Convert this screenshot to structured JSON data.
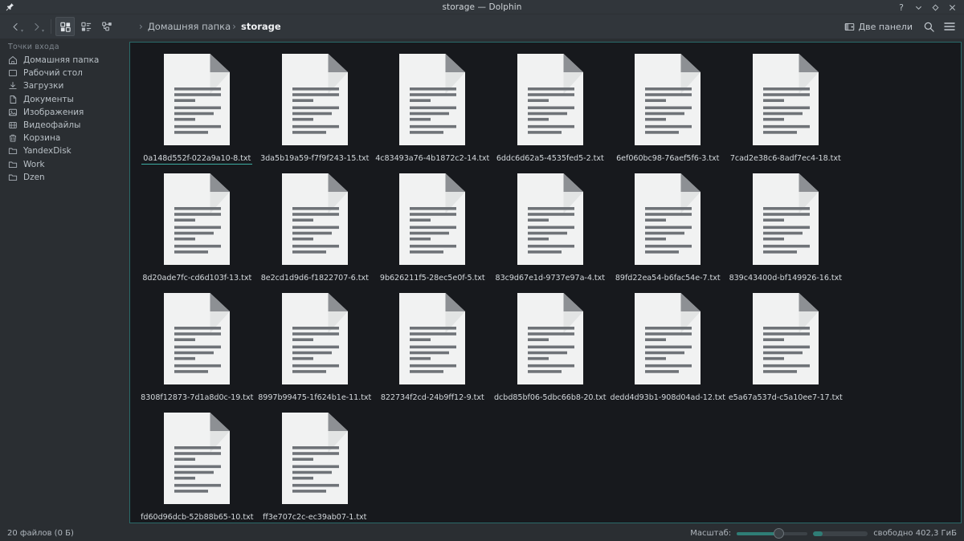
{
  "window": {
    "title": "storage — Dolphin",
    "pin_icon": "pin-icon",
    "controls": [
      {
        "name": "help-button",
        "glyph": "?"
      },
      {
        "name": "minimize-button",
        "glyph": "⌄"
      },
      {
        "name": "maximize-button",
        "glyph": "◇"
      },
      {
        "name": "close-button",
        "glyph": "✕"
      }
    ]
  },
  "toolbar": {
    "back_label": "‹",
    "forward_label": "›",
    "view_modes": [
      {
        "name": "view-mode-icons",
        "label": "Значки",
        "active": true
      },
      {
        "name": "view-mode-compact",
        "label": "Таблица",
        "active": false
      },
      {
        "name": "view-mode-details",
        "label": "Подробности",
        "active": false
      }
    ],
    "split_view_label": "Две панели",
    "search_label": "Поиск",
    "menu_label": "Меню"
  },
  "breadcrumb": {
    "items": [
      {
        "label": "Домашняя папка",
        "current": false
      },
      {
        "label": "storage",
        "current": true
      }
    ]
  },
  "sidebar": {
    "header": "Точки входа",
    "items": [
      {
        "label": "Домашняя папка",
        "icon": "home-icon"
      },
      {
        "label": "Рабочий стол",
        "icon": "desktop-icon"
      },
      {
        "label": "Загрузки",
        "icon": "downloads-icon"
      },
      {
        "label": "Документы",
        "icon": "documents-icon"
      },
      {
        "label": "Изображения",
        "icon": "images-icon"
      },
      {
        "label": "Видеофайлы",
        "icon": "videos-icon"
      },
      {
        "label": "Корзина",
        "icon": "trash-icon"
      },
      {
        "label": "YandexDisk",
        "icon": "folder-icon"
      },
      {
        "label": "Work",
        "icon": "folder-icon"
      },
      {
        "label": "Dzen",
        "icon": "folder-icon"
      }
    ]
  },
  "files": [
    {
      "name": "0a148d552f-022a9a10-8.txt",
      "current": true
    },
    {
      "name": "3da5b19a59-f7f9f243-15.txt",
      "current": false
    },
    {
      "name": "4c83493a76-4b1872c2-14.txt",
      "current": false
    },
    {
      "name": "6ddc6d62a5-4535fed5-2.txt",
      "current": false
    },
    {
      "name": "6ef060bc98-76aef5f6-3.txt",
      "current": false
    },
    {
      "name": "7cad2e38c6-8adf7ec4-18.txt",
      "current": false
    },
    {
      "name": "8d20ade7fc-cd6d103f-13.txt",
      "current": false
    },
    {
      "name": "8e2cd1d9d6-f1822707-6.txt",
      "current": false
    },
    {
      "name": "9b626211f5-28ec5e0f-5.txt",
      "current": false
    },
    {
      "name": "83c9d67e1d-9737e97a-4.txt",
      "current": false
    },
    {
      "name": "89fd22ea54-b6fac54e-7.txt",
      "current": false
    },
    {
      "name": "839c43400d-bf149926-16.txt",
      "current": false
    },
    {
      "name": "8308f12873-7d1a8d0c-19.txt",
      "current": false
    },
    {
      "name": "8997b99475-1f624b1e-11.txt",
      "current": false
    },
    {
      "name": "822734f2cd-24b9ff12-9.txt",
      "current": false
    },
    {
      "name": "dcbd85bf06-5dbc66b8-20.txt",
      "current": false
    },
    {
      "name": "dedd4d93b1-908d04ad-12.txt",
      "current": false
    },
    {
      "name": "e5a67a537d-c5a10ee7-17.txt",
      "current": false
    },
    {
      "name": "fd60d96dcb-52b88b65-10.txt",
      "current": false
    },
    {
      "name": "ff3e707c2c-ec39ab07-1.txt",
      "current": false
    }
  ],
  "statusbar": {
    "file_count_text": "20 файлов (0 Б)",
    "zoom_label": "Масштаб:",
    "zoom_percent": 60,
    "free_space_text": "свободно 402,3 ГиБ",
    "free_space_percent": 18
  },
  "colors": {
    "accent": "#3daea3",
    "view_border": "#2a6a69",
    "view_bg": "#17191d",
    "chrome_bg": "#31363b",
    "sidebar_bg": "#2a2e32"
  }
}
